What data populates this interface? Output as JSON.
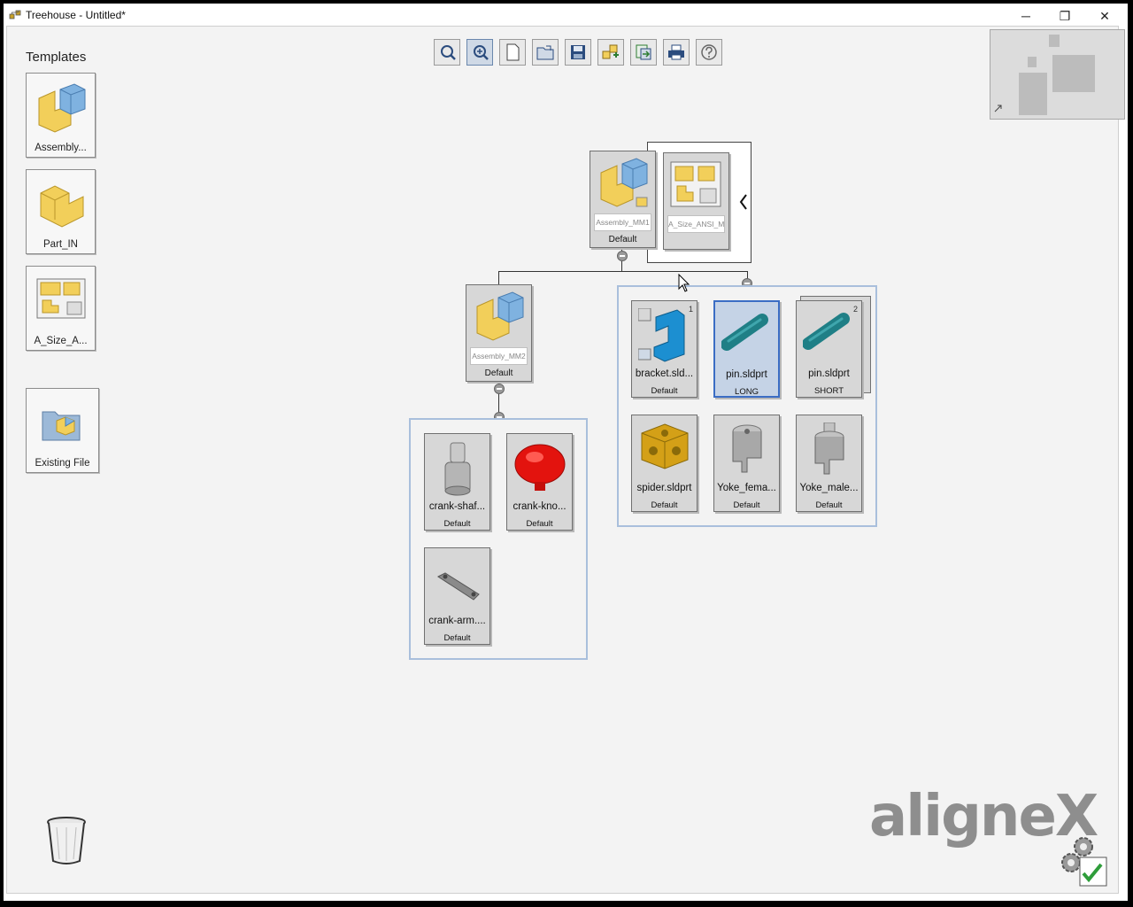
{
  "window": {
    "title": "Treehouse - Untitled*",
    "minimize": "─",
    "restore": "❐",
    "close": "✕"
  },
  "templates": {
    "heading": "Templates",
    "items": [
      {
        "label": "Assembly..."
      },
      {
        "label": "Part_IN"
      },
      {
        "label": "A_Size_A..."
      },
      {
        "label": "Existing File"
      }
    ]
  },
  "toolbar": {
    "buttons": [
      {
        "icon": "zoom-fit-icon"
      },
      {
        "icon": "zoom-select-icon",
        "active": true
      },
      {
        "icon": "new-document-icon"
      },
      {
        "icon": "open-folder-icon"
      },
      {
        "icon": "save-icon"
      },
      {
        "icon": "import-assembly-icon"
      },
      {
        "icon": "export-icon"
      },
      {
        "icon": "print-icon"
      },
      {
        "icon": "help-icon"
      }
    ]
  },
  "tree": {
    "root": {
      "name": "Assembly_MM1",
      "config": "Default"
    },
    "drawing": {
      "name": "A_Size_ANSI_M..."
    },
    "sub_assembly": {
      "name": "Assembly_MM2",
      "config": "Default"
    },
    "left_parts": [
      {
        "name": "crank-shaf...",
        "config": "Default"
      },
      {
        "name": "crank-kno...",
        "config": "Default"
      },
      {
        "name": "crank-arm....",
        "config": "Default"
      }
    ],
    "right_parts": [
      {
        "name": "bracket.sld...",
        "config": "Default",
        "badge": "1"
      },
      {
        "name": "pin.sldprt",
        "config": "LONG",
        "selected": true
      },
      {
        "name": "pin.sldprt",
        "config": "SHORT",
        "badge": "2"
      },
      {
        "name": "spider.sldprt",
        "config": "Default"
      },
      {
        "name": "Yoke_fema...",
        "config": "Default"
      },
      {
        "name": "Yoke_male...",
        "config": "Default"
      }
    ]
  },
  "branding": {
    "logo": "aligneX"
  },
  "colors": {
    "selection": "#3b6dc4",
    "group_border": "#a9bfdc",
    "part_teal": "#1f7f86",
    "assembly_yellow": "#f2cf5a"
  }
}
